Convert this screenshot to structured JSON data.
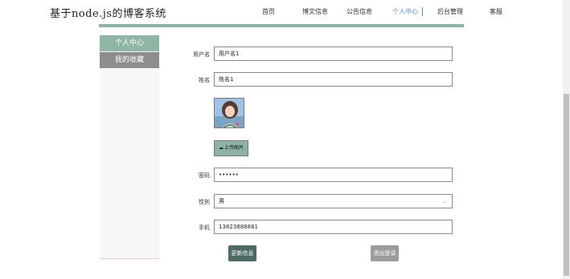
{
  "header": {
    "site_title": "基于node.js的博客系统",
    "nav": [
      "首页",
      "博文信息",
      "公告信息",
      "个人中心",
      "后台管理",
      "客服"
    ],
    "active_nav": "个人中心"
  },
  "sidebar": {
    "items": [
      "个人中心",
      "我的收藏"
    ]
  },
  "form": {
    "username": {
      "label": "用户名",
      "value": "用户名1"
    },
    "name": {
      "label": "姓名",
      "value": "姓名1"
    },
    "upload_label": "上传图片",
    "password": {
      "label": "密码",
      "value": "••••••"
    },
    "gender": {
      "label": "性别",
      "value": "男"
    },
    "phone": {
      "label": "手机",
      "value": "13823888881"
    }
  },
  "buttons": {
    "update": "更新信息",
    "logout": "退出登录"
  },
  "colors": {
    "accent_green": "#8fb3a3",
    "active_nav": "#5a8fd1",
    "update_button": "#4e6b63",
    "logout_button": "#9b9b9b"
  },
  "icons": {
    "upload": "cloud-upload-icon",
    "select": "chevron-down-icon"
  }
}
